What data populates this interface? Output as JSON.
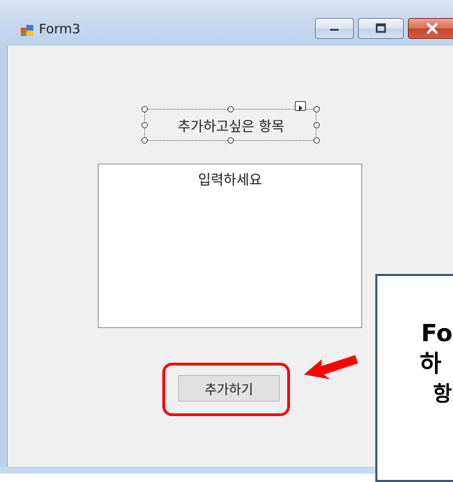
{
  "window": {
    "title": "Form3",
    "controls": [
      "minimize",
      "maximize",
      "close"
    ],
    "accent_close": "#c5452b"
  },
  "form": {
    "label_text": "추가하고싶은 항목",
    "textbox_text": "입력하세요",
    "add_button_label": "추가하기"
  },
  "annotation": {
    "callout_line1": "Fo",
    "callout_line2": "하",
    "callout_line3": "항",
    "highlight_color": "#ff0000",
    "arrow_color": "#ff0000"
  }
}
